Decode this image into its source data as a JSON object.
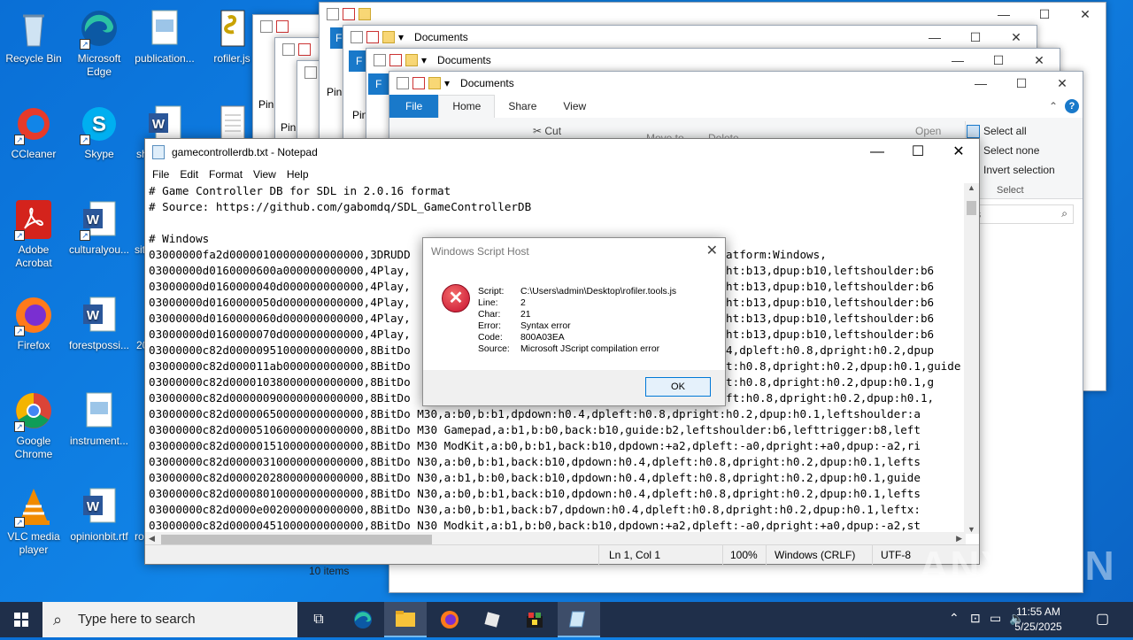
{
  "desktop": {
    "icons": [
      {
        "label": "Recycle Bin"
      },
      {
        "label": "Microsoft Edge"
      },
      {
        "label": "publication..."
      },
      {
        "label": "rofiler.js"
      },
      {
        "label": "CCleaner"
      },
      {
        "label": "Skype"
      },
      {
        "label": "sh"
      },
      {
        "label": "Adobe Acrobat"
      },
      {
        "label": "culturalyou..."
      },
      {
        "label": "sit"
      },
      {
        "label": "Firefox"
      },
      {
        "label": "forestpossi..."
      },
      {
        "label": "20"
      },
      {
        "label": "Google Chrome"
      },
      {
        "label": "instrument..."
      },
      {
        "label": "VLC media player"
      },
      {
        "label": "opinionbit.rtf"
      },
      {
        "label": "ro"
      }
    ]
  },
  "explorer": {
    "title": "Documents",
    "tabs": {
      "file": "File",
      "home": "Home",
      "share": "Share",
      "view": "View"
    },
    "ribbon": {
      "cut": "Cut",
      "move_to": "Move to",
      "delete": "Delete",
      "open": "Open",
      "select_all": "Select all",
      "select_none": "Select none",
      "invert_selection": "Invert selection",
      "group_select": "Select"
    },
    "items_count": "10 items",
    "pin_label": "Pin",
    "f_label": "F"
  },
  "notepad": {
    "title": "gamecontrollerdb.txt - Notepad",
    "menu": [
      "File",
      "Edit",
      "Format",
      "View",
      "Help"
    ],
    "lines": [
      "# Game Controller DB for SDL in 2.0.16 format",
      "# Source: https://github.com/gabomdq/SDL_GameControllerDB",
      "",
      "# Windows",
      "03000000fa2d00000100000000000000,3DRUDD                                              latform:Windows,",
      "03000000d0160000600a000000000000,4Play,                                            right:b13,dpup:b10,leftshoulder:b6",
      "03000000d0160000040d000000000000,4Play,                                            right:b13,dpup:b10,leftshoulder:b6",
      "03000000d0160000050d000000000000,4Play,                                            right:b13,dpup:b10,leftshoulder:b6",
      "03000000d0160000060d000000000000,4Play,                                            right:b13,dpup:b10,leftshoulder:b6",
      "03000000d0160000070d000000000000,4Play,                                            right:b13,dpup:b10,leftshoulder:b6",
      "03000000c82d00000951000000000000,8BitDo                                            h0.4,dpleft:h0.8,dpright:h0.2,dpup",
      "03000000c82d000011ab000000000000,8BitDo                                            left:h0.8,dpright:h0.2,dpup:h0.1,guide",
      "03000000c82d00001038000000000000,8BitDo                                            left:h0.8,dpright:h0.2,dpup:h0.1,g",
      "03000000c82d00000090000000000000,8BitDo                                            pleft:h0.8,dpright:h0.2,dpup:h0.1,",
      "03000000c82d00000650000000000000,8BitDo M30,a:b0,b:b1,dpdown:h0.4,dpleft:h0.8,dpright:h0.2,dpup:h0.1,leftshoulder:a",
      "03000000c82d00005106000000000000,8BitDo M30 Gamepad,a:b1,b:b0,back:b10,guide:b2,leftshoulder:b6,lefttrigger:b8,left",
      "03000000c82d00000151000000000000,8BitDo M30 ModKit,a:b0,b:b1,back:b10,dpdown:+a2,dpleft:-a0,dpright:+a0,dpup:-a2,ri",
      "03000000c82d00000310000000000000,8BitDo N30,a:b0,b:b1,back:b10,dpdown:h0.4,dpleft:h0.8,dpright:h0.2,dpup:h0.1,lefts",
      "03000000c82d00002028000000000000,8BitDo N30,a:b1,b:b0,back:b10,dpdown:h0.4,dpleft:h0.8,dpright:h0.2,dpup:h0.1,guide",
      "03000000c82d00008010000000000000,8BitDo N30,a:b0,b:b1,back:b10,dpdown:h0.4,dpleft:h0.8,dpright:h0.2,dpup:h0.1,lefts",
      "03000000c82d0000e002000000000000,8BitDo N30,a:b0,b:b1,back:b7,dpdown:h0.4,dpleft:h0.8,dpright:h0.2,dpup:h0.1,leftx:",
      "03000000c82d00000451000000000000,8BitDo N30 Modkit,a:b1,b:b0,back:b10,dpdown:+a2,dpleft:-a0,dpright:+a0,dpup:-a2,st"
    ],
    "status": {
      "position": "Ln 1, Col 1",
      "zoom": "100%",
      "line_ending": "Windows (CRLF)",
      "encoding": "UTF-8"
    }
  },
  "dialog": {
    "title": "Windows Script Host",
    "fields": [
      {
        "key": "Script:",
        "value": "C:\\Users\\admin\\Desktop\\rofiler.tools.js"
      },
      {
        "key": "Line:",
        "value": "2"
      },
      {
        "key": "Char:",
        "value": "21"
      },
      {
        "key": "Error:",
        "value": "Syntax error"
      },
      {
        "key": "Code:",
        "value": "800A03EA"
      },
      {
        "key": "Source:",
        "value": "Microsoft JScript compilation error"
      }
    ],
    "ok_label": "OK"
  },
  "taskbar": {
    "search_placeholder": "Type here to search",
    "time": "11:55 AM",
    "date": "5/25/2025"
  },
  "watermark": "ANY RUN",
  "colors": {
    "accent": "#0078d7",
    "file_tab": "#1979ca",
    "taskbar": "#1f2f4a",
    "error_red": "#c8102e"
  }
}
